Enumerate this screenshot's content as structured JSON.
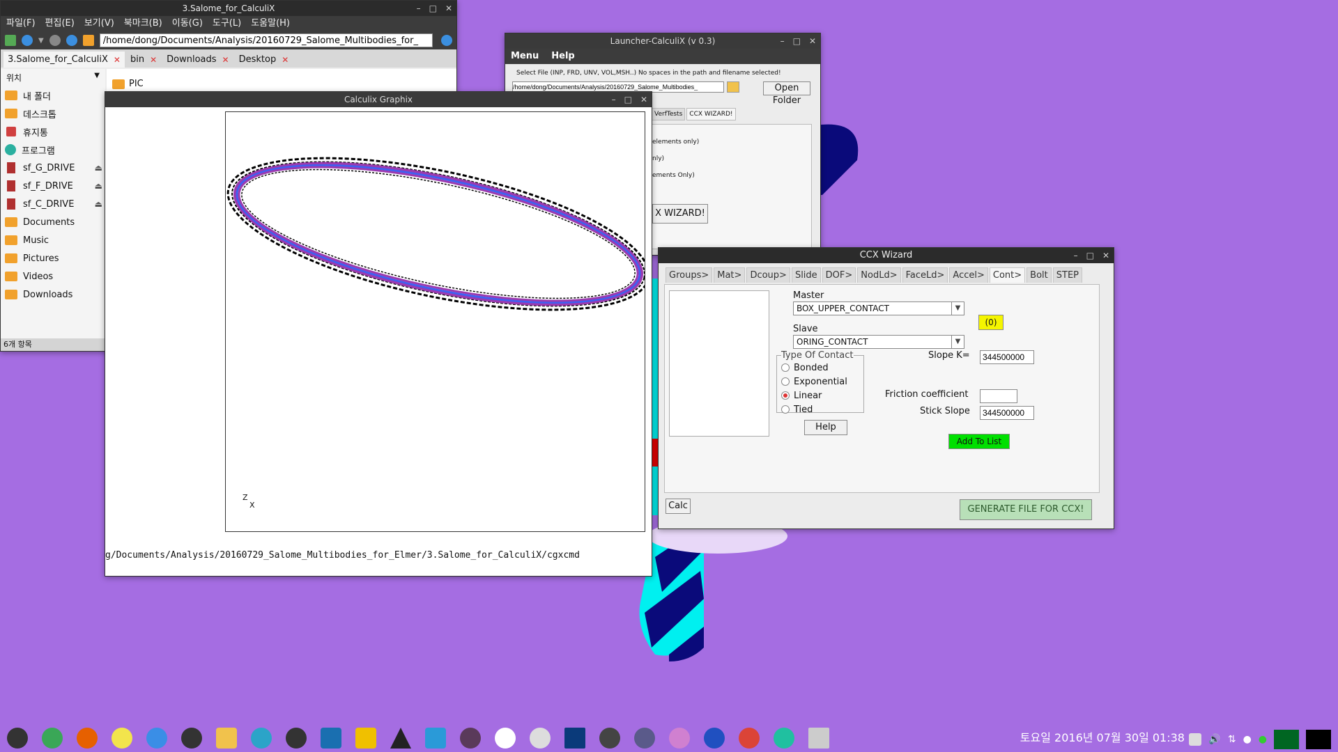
{
  "file_manager": {
    "title": "3.Salome_for_CalculiX",
    "menu": [
      "파일(F)",
      "편집(E)",
      "보기(V)",
      "북마크(B)",
      "이동(G)",
      "도구(L)",
      "도움말(H)"
    ],
    "path": "/home/dong/Documents/Analysis/20160729_Salome_Multibodies_for_",
    "tabs": [
      "3.Salome_for_CalculiX",
      "bin",
      "Downloads",
      "Desktop"
    ],
    "side_header": "위치",
    "places": [
      "내 폴더",
      "데스크톱",
      "휴지통",
      "프로그램",
      "sf_G_DRIVE",
      "sf_F_DRIVE",
      "sf_C_DRIVE",
      "Documents",
      "Music",
      "Pictures",
      "Videos",
      "Downloads"
    ],
    "first_file": "PIC",
    "status": "6개 항목"
  },
  "graphix": {
    "title": "Calculix Graphix",
    "axis_z": "Z",
    "axis_x": "X",
    "cmdline": "g/Documents/Analysis/20160729_Salome_Multibodies_for_Elmer/3.Salome_for_CalculiX/cgxcmd"
  },
  "launcher": {
    "title": "Launcher-CalculiX (v 0.3)",
    "menu": [
      "Menu",
      "Help"
    ],
    "select_hint": "Select File (INP, FRD, UNV, VOL,MSH..) No spaces in the path and filename selected!",
    "path": "/home/dong/Documents/Analysis/20160729_Salome_Multibodies_",
    "open_folder": "Open Folder",
    "tabs": [
      "VerfTests",
      "CCX WIZARD!"
    ],
    "lines": [
      "elements only)",
      "nly)",
      "ements Only)"
    ],
    "wizard_button": "X WIZARD!"
  },
  "wizard": {
    "title": "CCX Wizard",
    "tabs": [
      "Groups>",
      "Mat>",
      "Dcoup>",
      "Slide",
      "DOF>",
      "NodLd>",
      "FaceLd>",
      "Accel>",
      "Cont>",
      "Bolt",
      "STEP"
    ],
    "active_tab": "Cont>",
    "master_label": "Master",
    "master_value": "BOX_UPPER_CONTACT",
    "slave_label": "Slave",
    "slave_value": "ORING_CONTACT",
    "count_badge": "(0)",
    "contact_type_label": "Type Of Contact",
    "contact_types": [
      "Bonded",
      "Exponential",
      "Linear",
      "Tied"
    ],
    "selected_type": "Linear",
    "help": "Help",
    "slope_label": "Slope K=",
    "slope_value": "344500000",
    "friction_label": "Friction coefficient",
    "friction_value": "",
    "stick_label": "Stick Slope",
    "stick_value": "344500000",
    "add_to_list": "Add To List",
    "calc": "Calc",
    "generate": "GENERATE FILE FOR CCX!"
  },
  "taskbar": {
    "clock": "토요일 2016년 07월 30일 01:38"
  },
  "colors": {
    "desktop": "#a56de2",
    "add_button": "#00e000",
    "badge": "#f5f500",
    "generate": "#b8e0b8",
    "ring_purple": "#9b3ab0",
    "ring_blue": "#4060f0"
  }
}
